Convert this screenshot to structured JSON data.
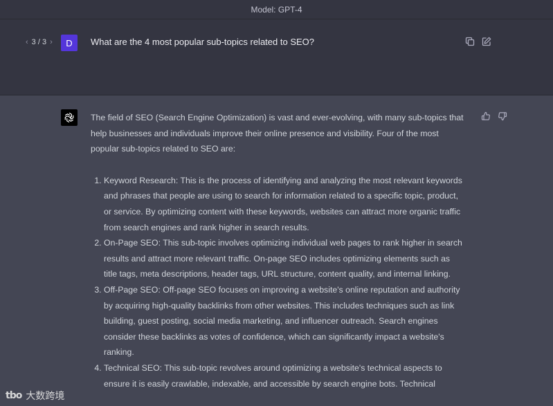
{
  "topbar": {
    "model_label": "Model: GPT-4"
  },
  "user_message": {
    "pager_prev": "‹",
    "pager_count": "3 / 3",
    "pager_next": "›",
    "avatar_initial": "D",
    "text": "What are the 4 most popular sub-topics related to SEO?",
    "icons": [
      "copy-icon",
      "edit-icon"
    ]
  },
  "assistant_message": {
    "avatar_icon": "openai-logo-icon",
    "intro": "The field of SEO (Search Engine Optimization) is vast and ever-evolving, with many sub-topics that help businesses and individuals improve their online presence and visibility. Four of the most popular sub-topics related to SEO are:",
    "items": [
      "Keyword Research: This is the process of identifying and analyzing the most relevant keywords and phrases that people are using to search for information related to a specific topic, product, or service. By optimizing content with these keywords, websites can attract more organic traffic from search engines and rank higher in search results.",
      "On-Page SEO: This sub-topic involves optimizing individual web pages to rank higher in search results and attract more relevant traffic. On-page SEO includes optimizing elements such as title tags, meta descriptions, header tags, URL structure, content quality, and internal linking.",
      "Off-Page SEO: Off-page SEO focuses on improving a website's online reputation and authority by acquiring high-quality backlinks from other websites. This includes techniques such as link building, guest posting, social media marketing, and influencer outreach. Search engines consider these backlinks as votes of confidence, which can significantly impact a website's ranking.",
      "Technical SEO: This sub-topic revolves around optimizing a website's technical aspects to ensure it is easily crawlable, indexable, and accessible by search engine bots. Technical"
    ],
    "icons": [
      "thumbs-up-icon",
      "thumbs-down-icon"
    ]
  },
  "watermark": {
    "logo": "tbo",
    "text": "大数跨境"
  }
}
